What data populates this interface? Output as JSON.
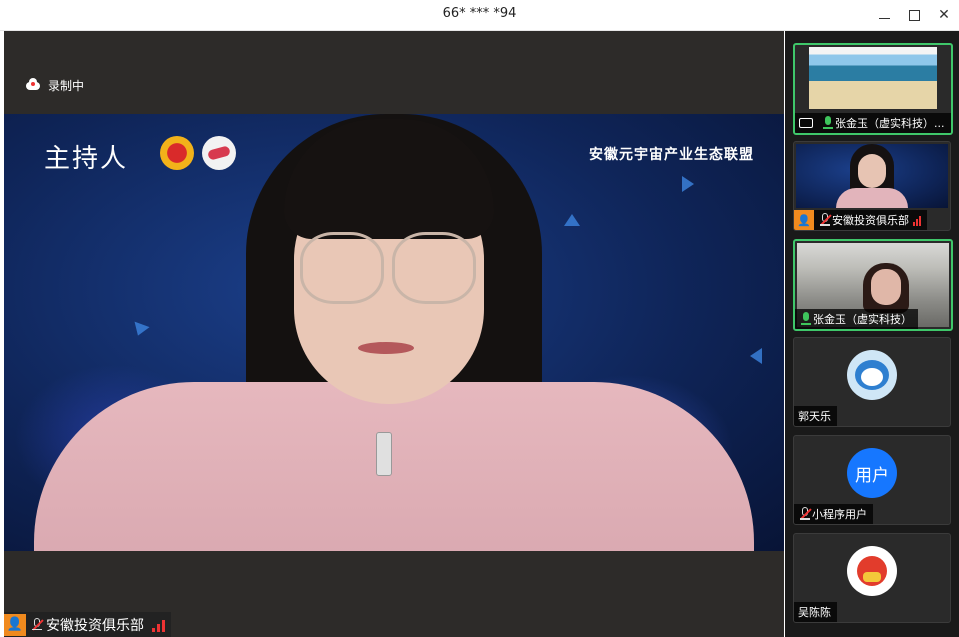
{
  "window": {
    "title": "66* *** *94"
  },
  "stage": {
    "recording_label": "录制中",
    "video": {
      "host_text": "主持人",
      "alliance_text": "安徽元宇宙产业生态联盟"
    },
    "current_speaker": {
      "name": "安徽投资俱乐部"
    }
  },
  "participants": [
    {
      "name": "张金玉（虚实科技）...",
      "state": "sharing",
      "mic": "on"
    },
    {
      "name": "安徽投资俱乐部",
      "state": "video",
      "mic": "muted"
    },
    {
      "name": "张金玉（虚实科技）",
      "state": "video",
      "mic": "on"
    },
    {
      "name": "郭天乐",
      "state": "avatar"
    },
    {
      "name": "小程序用户",
      "state": "avatar",
      "avatar_text": "用户",
      "mic": "muted"
    },
    {
      "name": "吴陈陈",
      "state": "avatar"
    }
  ],
  "colors": {
    "active_border": "#3fc76a",
    "user_avatar": "#1677ff",
    "speaker_badge": "#f08a1e",
    "signal": "#e33333"
  }
}
